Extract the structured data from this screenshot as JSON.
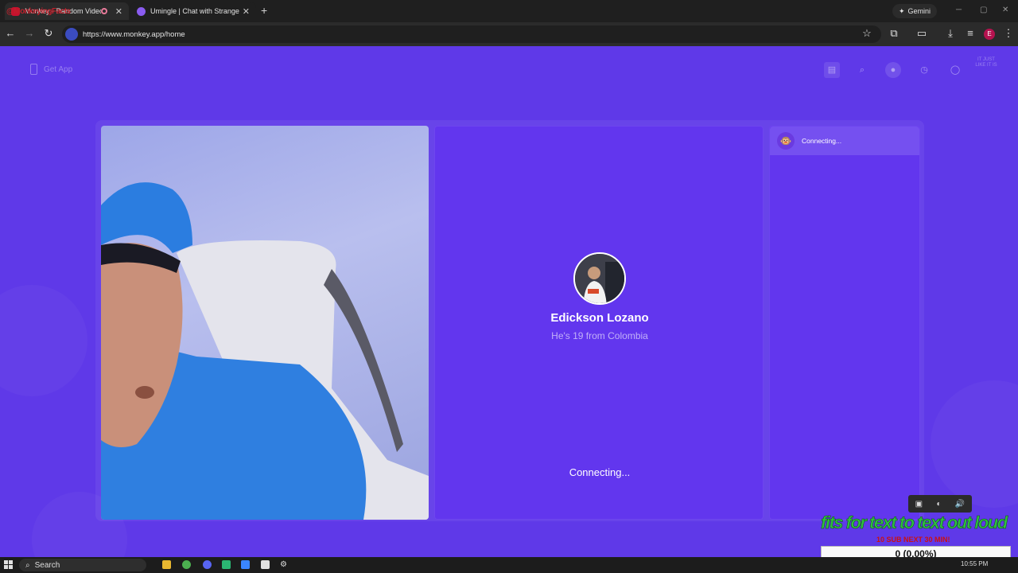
{
  "browser": {
    "watermark": "@MonkeyingFacts",
    "tabs": [
      {
        "title": "Monkey - Random Video Chat",
        "active": true
      },
      {
        "title": "Umingle | Chat with Strangers",
        "active": false
      }
    ],
    "gemini_label": "Gemini",
    "url": "https://www.monkey.app/home",
    "profile_initial": "E"
  },
  "page": {
    "get_app": "Get App",
    "profile_dim_text": "IT JUST LIKE IT IS",
    "chat_panel": {
      "status": "Connecting..."
    },
    "match": {
      "name": "Edickson Lozano",
      "details": "He's 19 from Colombia",
      "status": "Connecting..."
    }
  },
  "overlay": {
    "tts_banner": "fits for text to text out loud",
    "sub_goal": "10 SUB NEXT 30 MIN!",
    "counter": "0 (0.00%)"
  },
  "taskbar": {
    "search_placeholder": "Search",
    "time": "10:55 PM"
  },
  "colors": {
    "page_bg": "#5f39e8",
    "panel_bg": "#6236ee",
    "chrome_bg": "#2b2b2b"
  }
}
